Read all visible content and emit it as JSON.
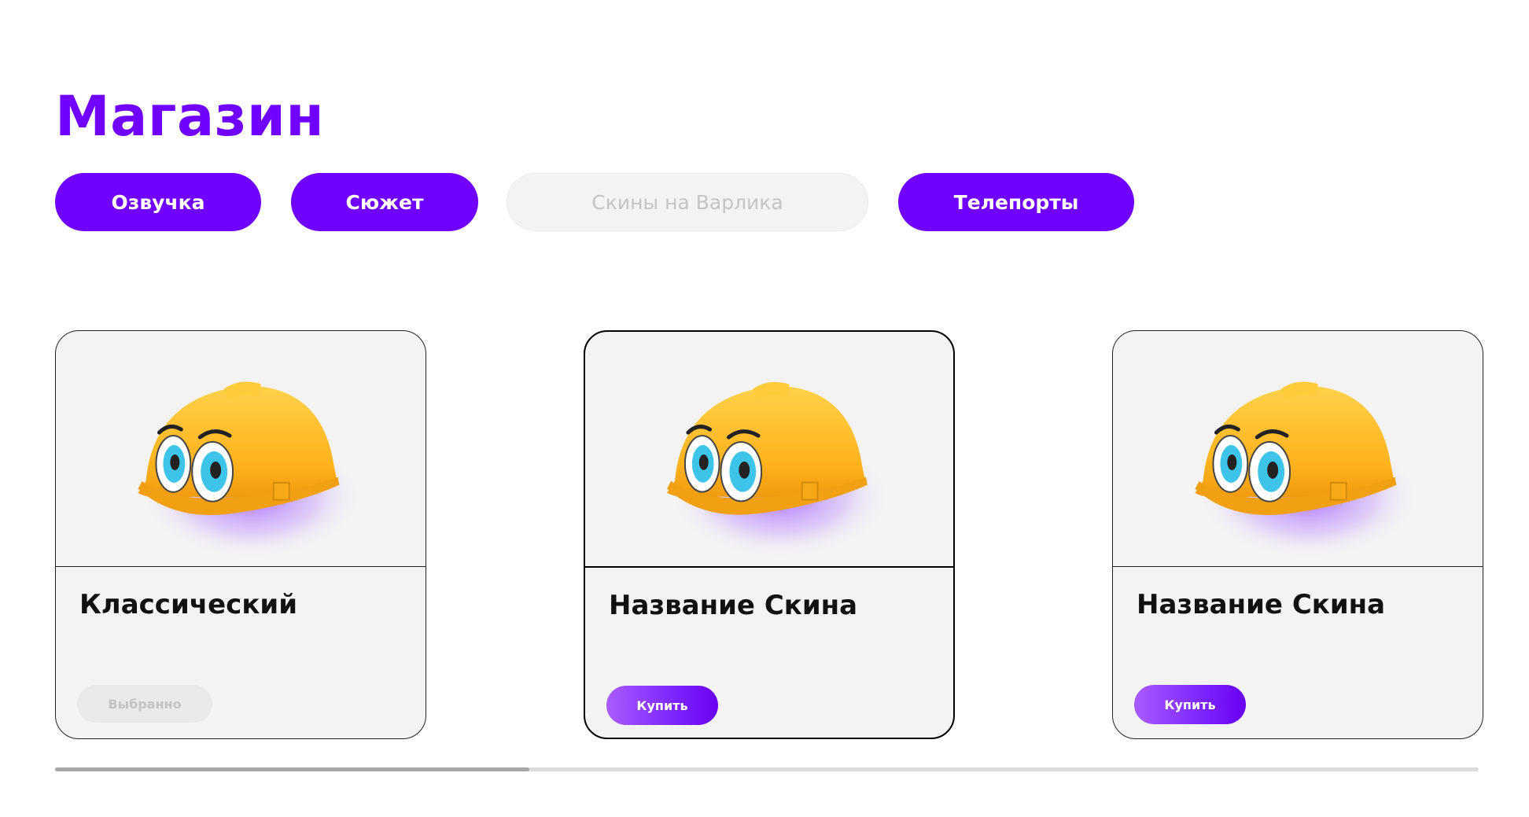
{
  "page": {
    "title": "Магазин"
  },
  "tabs": [
    {
      "label": "Озвучка",
      "active": true
    },
    {
      "label": "Сюжет",
      "active": true
    },
    {
      "label": "Скины на Варлика",
      "active": false
    },
    {
      "label": "Телепорты",
      "active": true
    }
  ],
  "cards": [
    {
      "title": "Классический",
      "button": "Выбранно",
      "selected": false
    },
    {
      "title": "Название Скина",
      "button": "Купить",
      "selected": true
    },
    {
      "title": "Название Скина",
      "button": "Купить",
      "selected": false
    }
  ],
  "icons": {
    "card_image": "hardhat-mascot-icon"
  },
  "colors": {
    "accent": "#7000ff",
    "card_bg": "#f3f3f3",
    "inactive_tab_text": "#c4c4c4"
  },
  "scroll": {
    "position_fraction": 0.33
  }
}
